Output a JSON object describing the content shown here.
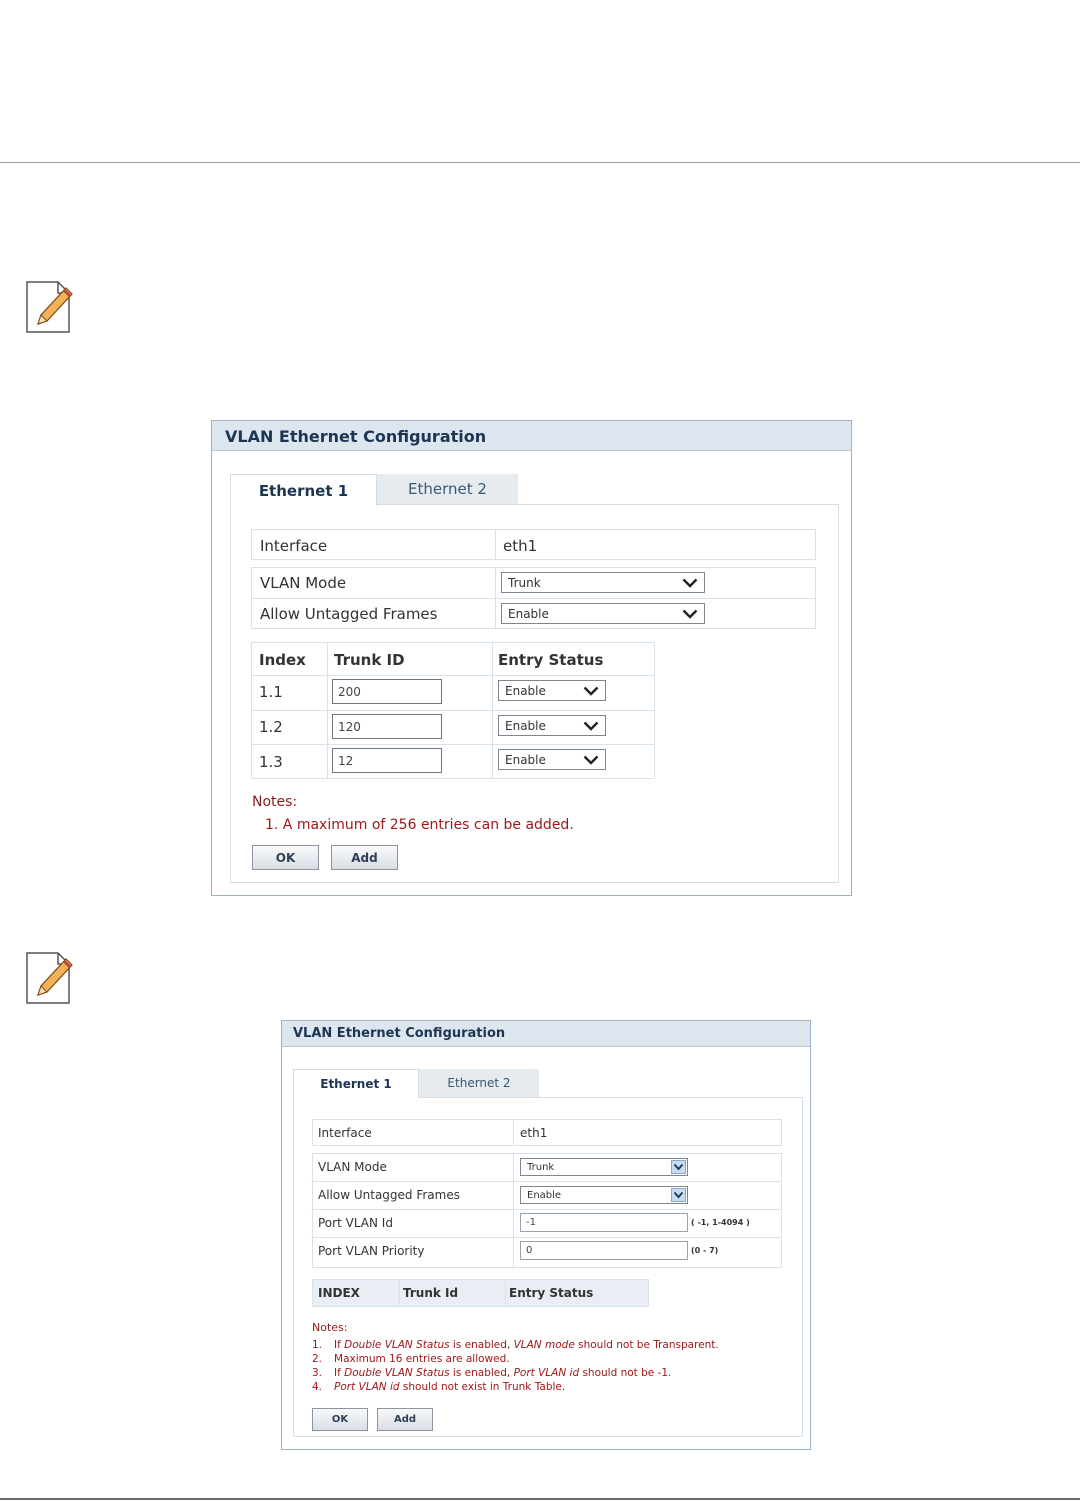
{
  "panel1": {
    "title": "VLAN Ethernet Configuration",
    "tabs": [
      "Ethernet 1",
      "Ethernet 2"
    ],
    "interface_label": "Interface",
    "interface_value": "eth1",
    "vlan_mode_label": "VLAN Mode",
    "vlan_mode_value": "Trunk",
    "allow_untagged_label": "Allow Untagged Frames",
    "allow_untagged_value": "Enable",
    "table_headers": [
      "Index",
      "Trunk ID",
      "Entry Status"
    ],
    "rows": [
      {
        "index": "1.1",
        "trunk_id": "200",
        "status": "Enable"
      },
      {
        "index": "1.2",
        "trunk_id": "120",
        "status": "Enable"
      },
      {
        "index": "1.3",
        "trunk_id": "12",
        "status": "Enable"
      }
    ],
    "notes_title": "Notes:",
    "note1": "1. A maximum of 256 entries can be added.",
    "ok_label": "OK",
    "add_label": "Add"
  },
  "panel2": {
    "title": "VLAN Ethernet Configuration",
    "tabs": [
      "Ethernet 1",
      "Ethernet 2"
    ],
    "interface_label": "Interface",
    "interface_value": "eth1",
    "vlan_mode_label": "VLAN Mode",
    "vlan_mode_value": "Trunk",
    "allow_untagged_label": "Allow Untagged Frames",
    "allow_untagged_value": "Enable",
    "port_vlan_id_label": "Port VLAN Id",
    "port_vlan_id_value": "-1",
    "port_vlan_id_range": "( -1, 1-4094 )",
    "port_vlan_priority_label": "Port VLAN Priority",
    "port_vlan_priority_value": "0",
    "port_vlan_priority_range": "(0 - 7)",
    "table_headers": [
      "INDEX",
      "Trunk Id",
      "Entry Status"
    ],
    "notes_title": "Notes:",
    "notes": {
      "n1_num": "1.",
      "n1_a": "If ",
      "n1_b": "Double VLAN Status",
      "n1_c": " is enabled, ",
      "n1_d": "VLAN mode",
      "n1_e": " should not be Transparent.",
      "n2_num": "2.",
      "n2": "Maximum 16 entries are allowed.",
      "n3_num": "3.",
      "n3_a": "If ",
      "n3_b": "Double VLAN Status",
      "n3_c": " is enabled, ",
      "n3_d": "Port VLAN id",
      "n3_e": " should not be -1.",
      "n4_num": "4.",
      "n4_a": "Port VLAN id",
      "n4_b": " should not exist in Trunk Table."
    },
    "ok_label": "OK",
    "add_label": "Add"
  },
  "icons": [
    "note-pencil-icon",
    "chevron-down-icon",
    "select-arrow-icon"
  ],
  "colors": {
    "title_bar": "#dde6ef",
    "title_text": "#1c3553",
    "note_text": "#a01818",
    "border": "#9fb3c8"
  }
}
